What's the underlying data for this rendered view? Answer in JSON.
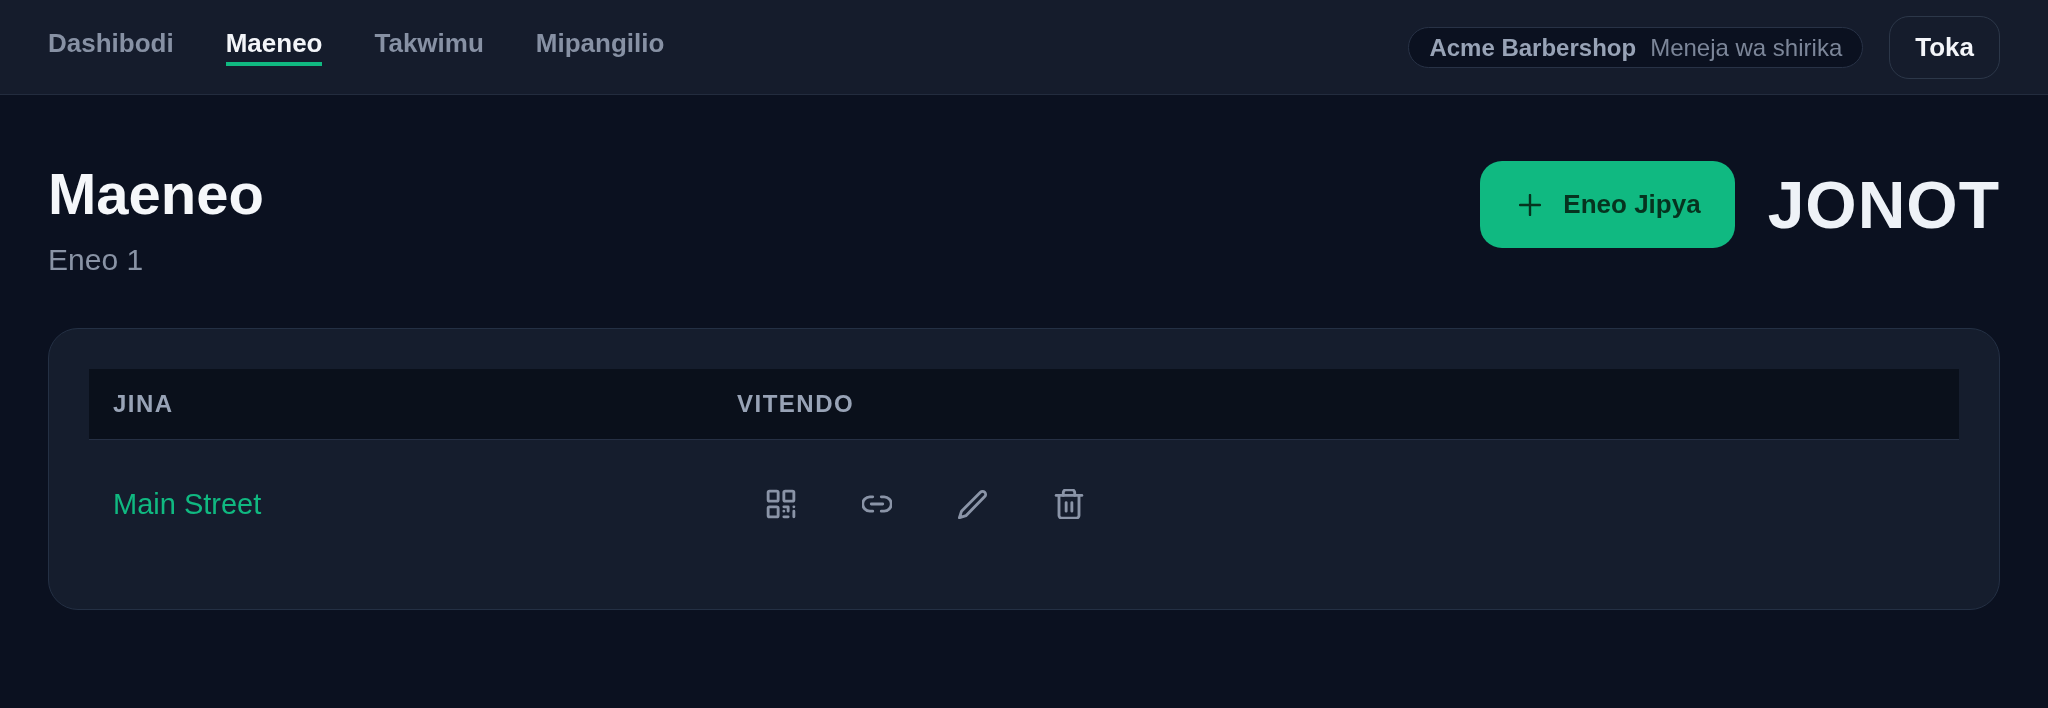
{
  "nav": {
    "items": [
      {
        "label": "Dashibodi",
        "selected": false
      },
      {
        "label": "Maeneo",
        "selected": true
      },
      {
        "label": "Takwimu",
        "selected": false
      },
      {
        "label": "Mipangilio",
        "selected": false
      }
    ]
  },
  "account": {
    "company": "Acme Barbershop",
    "role": "Meneja wa shirika"
  },
  "logout_button": {
    "label": "Toka"
  },
  "header": {
    "title": "Maeneo",
    "subtitle": "Eneo 1"
  },
  "new_button": {
    "label": "Eneo Jipya"
  },
  "logo": {
    "text": "JONOT"
  },
  "table": {
    "columns": [
      "JINA",
      "VITENDO"
    ],
    "rows": [
      {
        "name": "Main Street"
      }
    ]
  }
}
